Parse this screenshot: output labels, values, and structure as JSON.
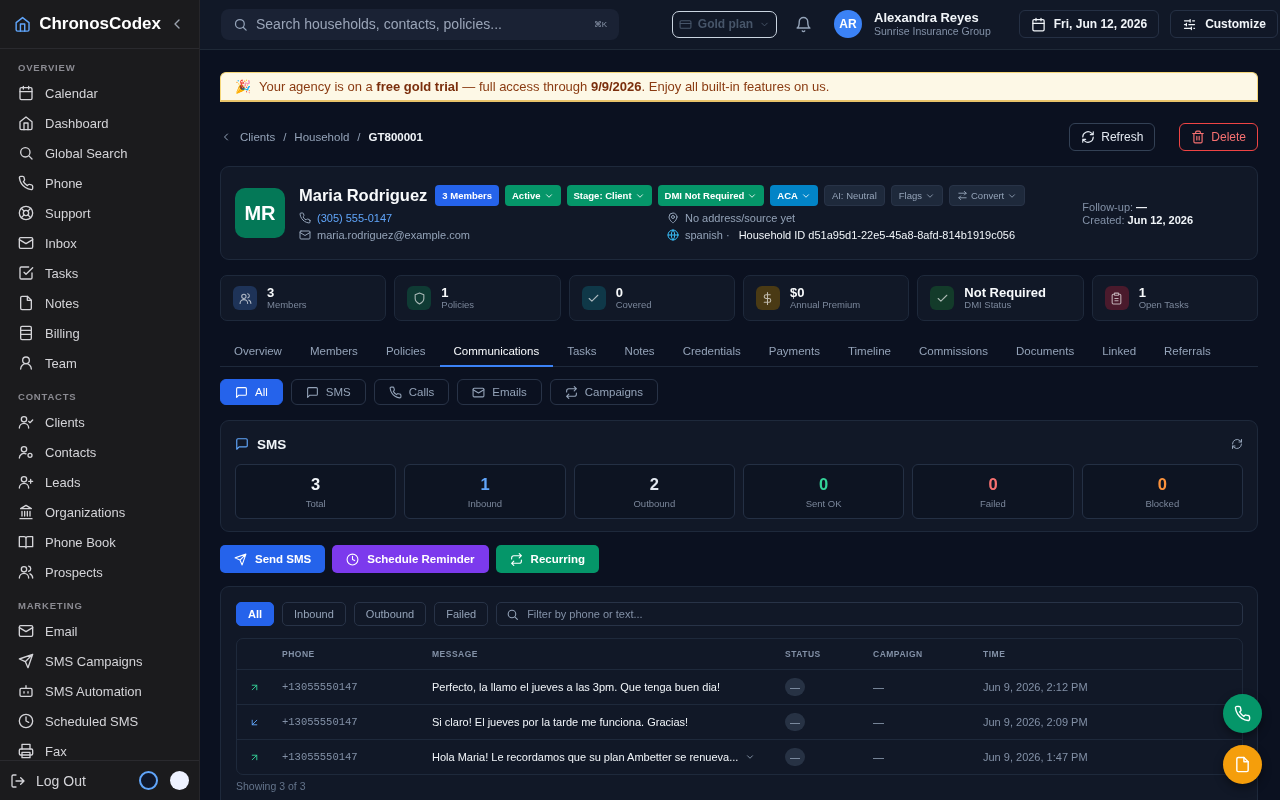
{
  "app": {
    "name": "ChronosCodex"
  },
  "sidebar": {
    "sections": [
      {
        "title": "OVERVIEW",
        "items": [
          {
            "label": "Calendar"
          },
          {
            "label": "Dashboard"
          },
          {
            "label": "Global Search"
          },
          {
            "label": "Phone"
          },
          {
            "label": "Support"
          },
          {
            "label": "Inbox"
          },
          {
            "label": "Tasks"
          },
          {
            "label": "Notes"
          },
          {
            "label": "Billing"
          },
          {
            "label": "Team"
          }
        ]
      },
      {
        "title": "CONTACTS",
        "items": [
          {
            "label": "Clients"
          },
          {
            "label": "Contacts"
          },
          {
            "label": "Leads"
          },
          {
            "label": "Organizations"
          },
          {
            "label": "Phone Book"
          },
          {
            "label": "Prospects"
          }
        ]
      },
      {
        "title": "MARKETING",
        "items": [
          {
            "label": "Email"
          },
          {
            "label": "SMS Campaigns"
          },
          {
            "label": "SMS Automation"
          },
          {
            "label": "Scheduled SMS"
          },
          {
            "label": "Fax"
          }
        ]
      }
    ],
    "logout": "Log Out",
    "themes": [
      {
        "selected": true,
        "color": "#0f172a"
      },
      {
        "selected": false,
        "color": "#eef2ff"
      }
    ]
  },
  "topbar": {
    "search": {
      "placeholder": "Search households, contacts, policies...",
      "shortcut": "⌘K"
    },
    "plan": {
      "label": "Gold plan",
      "disabled": true
    },
    "user": {
      "initials": "AR",
      "name": "Alexandra Reyes",
      "org": "Sunrise Insurance Group"
    },
    "date": "Fri, Jun 12, 2026",
    "customize": "Customize"
  },
  "banner": {
    "emoji": "🎉",
    "text": "Your agency is on a **free gold trial** — full access through **9/9/2026**. Enjoy all built-in features on us."
  },
  "breadcrumb": {
    "separator": "/",
    "items": [
      "Clients",
      "Household",
      "GT800001"
    ]
  },
  "page_actions": [
    {
      "label": "Refresh",
      "kind": "refresh"
    },
    {
      "label": "Delete",
      "kind": "delete"
    }
  ],
  "household": {
    "initials": "MR",
    "name": "Maria Rodriguez",
    "badges": [
      {
        "label": "3 Members",
        "color": "#2563eb",
        "dropdown": false,
        "muted": false,
        "kind": "tag"
      },
      {
        "label": "Active",
        "color": "#059669",
        "dropdown": true,
        "muted": false,
        "kind": "tag"
      },
      {
        "label": "Stage: Client",
        "color": "#059669",
        "dropdown": true,
        "muted": false,
        "kind": "tag"
      },
      {
        "label": "DMI Not Required",
        "color": "#059669",
        "dropdown": true,
        "muted": false,
        "kind": "tag"
      },
      {
        "label": "ACA",
        "color": "#0284c7",
        "dropdown": true,
        "muted": false,
        "kind": "tag"
      },
      {
        "label": "AI: Neutral",
        "color": "#1e293b",
        "dropdown": false,
        "muted": true,
        "kind": "tag"
      },
      {
        "label": "Flags",
        "color": "#1e293b",
        "dropdown": true,
        "muted": true,
        "kind": "tag"
      },
      {
        "label": "Convert",
        "color": "#1e293b",
        "dropdown": true,
        "muted": true,
        "kind": "convert"
      }
    ],
    "phone": "(305) 555-0147",
    "email": "maria.rodriguez@example.com",
    "address": "No address/source yet",
    "language": "spanish ·",
    "household_id": "Household ID d51a95d1-22e5-45a8-8afd-814b1919c056",
    "follow_up_label": "Follow-up:",
    "follow_up": "—",
    "created_label": "Created:",
    "created": "Jun 12, 2026"
  },
  "stats": [
    {
      "value": "3",
      "label": "Members",
      "color": "#1e3358"
    },
    {
      "value": "1",
      "label": "Policies",
      "color": "#0f3b34"
    },
    {
      "value": "0",
      "label": "Covered",
      "color": "#0f3848"
    },
    {
      "value": "$0",
      "label": "Annual Premium",
      "color": "#4a3a14"
    },
    {
      "value": "Not Required",
      "label": "DMI Status",
      "color": "#133b2a"
    },
    {
      "value": "1",
      "label": "Open Tasks",
      "color": "#4a1a2c"
    }
  ],
  "tabs": [
    {
      "label": "Overview",
      "selected": false
    },
    {
      "label": "Members",
      "selected": false
    },
    {
      "label": "Policies",
      "selected": false
    },
    {
      "label": "Communications",
      "selected": true
    },
    {
      "label": "Tasks",
      "selected": false
    },
    {
      "label": "Notes",
      "selected": false
    },
    {
      "label": "Credentials",
      "selected": false
    },
    {
      "label": "Payments",
      "selected": false
    },
    {
      "label": "Timeline",
      "selected": false
    },
    {
      "label": "Commissions",
      "selected": false
    },
    {
      "label": "Documents",
      "selected": false
    },
    {
      "label": "Linked",
      "selected": false
    },
    {
      "label": "Referrals",
      "selected": false
    }
  ],
  "channel_filters": [
    {
      "label": "All",
      "selected": true
    },
    {
      "label": "SMS",
      "selected": false
    },
    {
      "label": "Calls",
      "selected": false
    },
    {
      "label": "Emails",
      "selected": false
    },
    {
      "label": "Campaigns",
      "selected": false
    }
  ],
  "sms": {
    "title": "SMS",
    "counters": [
      {
        "value": "3",
        "label": "Total",
        "color": "#f1f5f9"
      },
      {
        "value": "1",
        "label": "Inbound",
        "color": "#60a5fa"
      },
      {
        "value": "2",
        "label": "Outbound",
        "color": "#e2e8f0"
      },
      {
        "value": "0",
        "label": "Sent OK",
        "color": "#34d399"
      },
      {
        "value": "0",
        "label": "Failed",
        "color": "#f87171"
      },
      {
        "value": "0",
        "label": "Blocked",
        "color": "#fb923c"
      }
    ]
  },
  "sms_actions": [
    {
      "label": "Send SMS",
      "color": "#2563eb"
    },
    {
      "label": "Schedule Reminder",
      "color": "#7c3aed"
    },
    {
      "label": "Recurring",
      "color": "#059669"
    }
  ],
  "log": {
    "filters": [
      {
        "label": "All",
        "selected": true
      },
      {
        "label": "Inbound",
        "selected": false
      },
      {
        "label": "Outbound",
        "selected": false
      },
      {
        "label": "Failed",
        "selected": false
      }
    ],
    "search_placeholder": "Filter by phone or text...",
    "columns": [
      "PHONE",
      "MESSAGE",
      "STATUS",
      "CAMPAIGN",
      "TIME"
    ],
    "rows": [
      {
        "kind": "outbound",
        "phone": "+13055550147",
        "message": "Perfecto, la llamo el jueves a las 3pm. Que tenga buen dia!",
        "expandable": false,
        "status": "—",
        "campaign": "—",
        "time": "Jun 9, 2026, 2:12 PM"
      },
      {
        "kind": "inbound",
        "phone": "+13055550147",
        "message": "Si claro! El jueves por la tarde me funciona. Gracias!",
        "expandable": false,
        "status": "—",
        "campaign": "—",
        "time": "Jun 9, 2026, 2:09 PM"
      },
      {
        "kind": "outbound",
        "phone": "+13055550147",
        "message": "Hola Maria! Le recordamos que su plan Ambetter se renueva...",
        "expandable": true,
        "status": "—",
        "campaign": "—",
        "time": "Jun 9, 2026, 1:47 PM"
      }
    ],
    "footer": "Showing 3 of 3"
  }
}
